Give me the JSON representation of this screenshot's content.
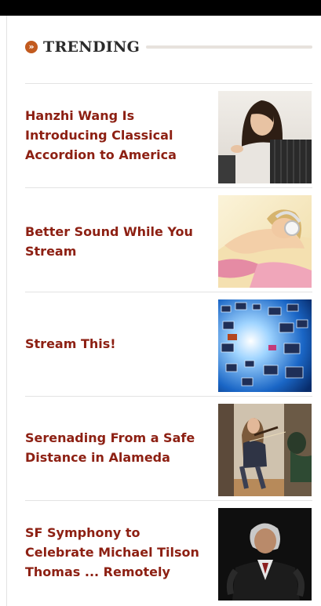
{
  "trending": {
    "title": "TRENDING",
    "icon": "chevron-right-circle-icon",
    "accent_color": "#c25a1e",
    "link_color": "#8d2013",
    "items": [
      {
        "title": "Hanzhi Wang Is Introducing Classical Accordion to America"
      },
      {
        "title": "Better Sound While You Stream"
      },
      {
        "title": "Stream This!"
      },
      {
        "title": "Serenading From a Safe Distance in Alameda"
      },
      {
        "title": "SF Symphony to Celebrate Michael Tilson Thomas ... Remotely"
      }
    ]
  }
}
